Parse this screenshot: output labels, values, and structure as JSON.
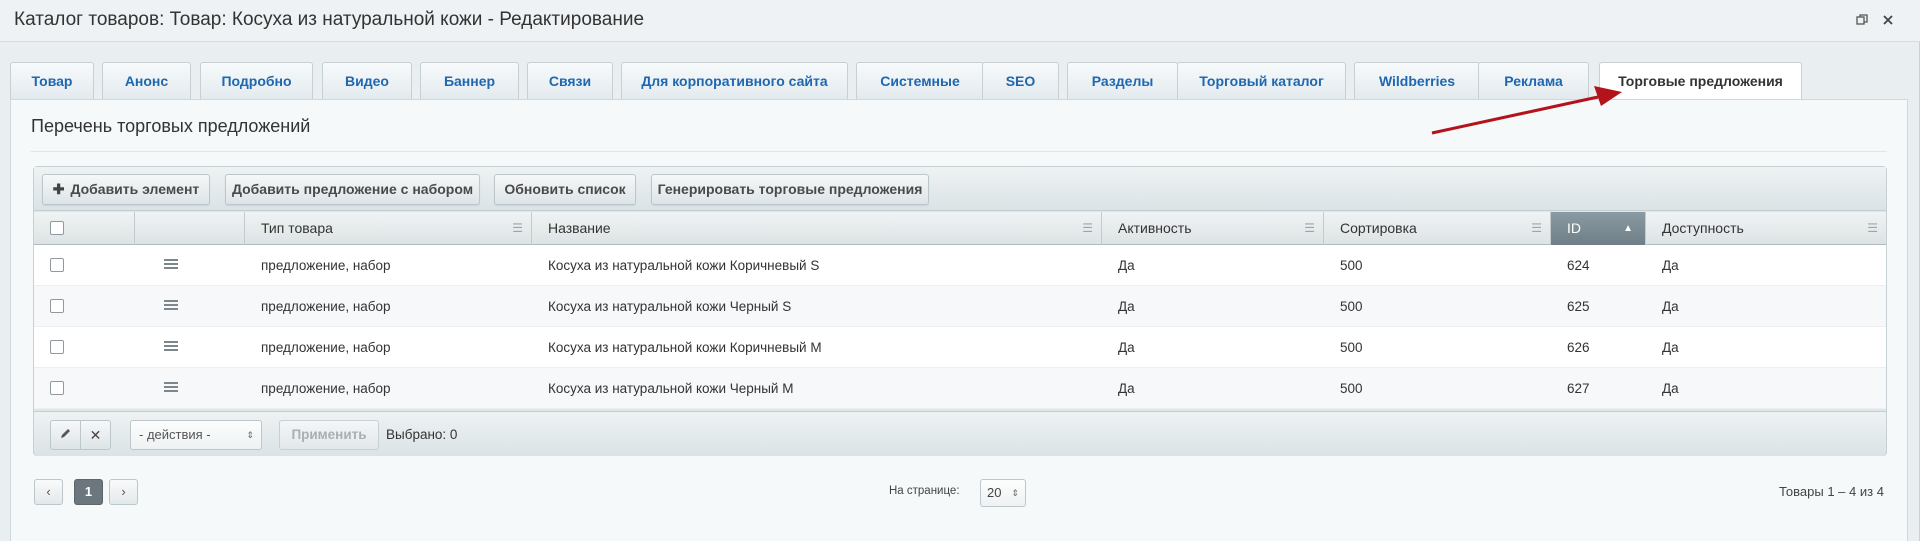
{
  "window": {
    "title": "Каталог товаров: Товар: Косуха из натуральной кожи - Редактирование",
    "restore_icon": "restore-icon",
    "close_icon": "close-icon"
  },
  "tabs": [
    {
      "label": "Товар",
      "active": false
    },
    {
      "label": "Анонс",
      "active": false
    },
    {
      "label": "Подробно",
      "active": false
    },
    {
      "label": "Видео",
      "active": false
    },
    {
      "label": "Баннер",
      "active": false
    },
    {
      "label": "Связи",
      "active": false
    },
    {
      "label": "Для корпоративного сайта",
      "active": false
    },
    {
      "label": "Системные",
      "active": false
    },
    {
      "label": "SEO",
      "active": false
    },
    {
      "label": "Разделы",
      "active": false
    },
    {
      "label": "Торговый каталог",
      "active": false
    },
    {
      "label": "Wildberries",
      "active": false
    },
    {
      "label": "Реклама",
      "active": false
    },
    {
      "label": "Торговые предложения",
      "active": true
    }
  ],
  "section": {
    "title": "Перечень торговых предложений"
  },
  "toolbar": {
    "add_element": "Добавить элемент",
    "add_set_offer": "Добавить предложение с набором",
    "refresh_list": "Обновить список",
    "generate_offers": "Генерировать торговые предложения"
  },
  "table": {
    "columns": [
      "Тип товара",
      "Название",
      "Активность",
      "Сортировка",
      "ID",
      "Доступность"
    ],
    "sorted_column": "ID",
    "sort_direction": "asc",
    "rows": [
      {
        "type": "предложение, набор",
        "name": "Косуха из натуральной кожи Коричневый S",
        "active": "Да",
        "sort": "500",
        "id": "624",
        "available": "Да"
      },
      {
        "type": "предложение, набор",
        "name": "Косуха из натуральной кожи Черный S",
        "active": "Да",
        "sort": "500",
        "id": "625",
        "available": "Да"
      },
      {
        "type": "предложение, набор",
        "name": "Косуха из натуральной кожи Коричневый M",
        "active": "Да",
        "sort": "500",
        "id": "626",
        "available": "Да"
      },
      {
        "type": "предложение, набор",
        "name": "Косуха из натуральной кожи Черный M",
        "active": "Да",
        "sort": "500",
        "id": "627",
        "available": "Да"
      }
    ]
  },
  "footer": {
    "actions_select": "- действия -",
    "apply": "Применить",
    "selected": "Выбрано: 0"
  },
  "pager": {
    "prev": "‹",
    "current": "1",
    "next": "›",
    "per_page_label": "На странице:",
    "per_page_value": "20",
    "total": "Товары 1 – 4 из 4"
  },
  "colors": {
    "tab_link": "#2067b0",
    "annotation_arrow": "#b3131b",
    "sorted_header": "#7b8b93"
  }
}
